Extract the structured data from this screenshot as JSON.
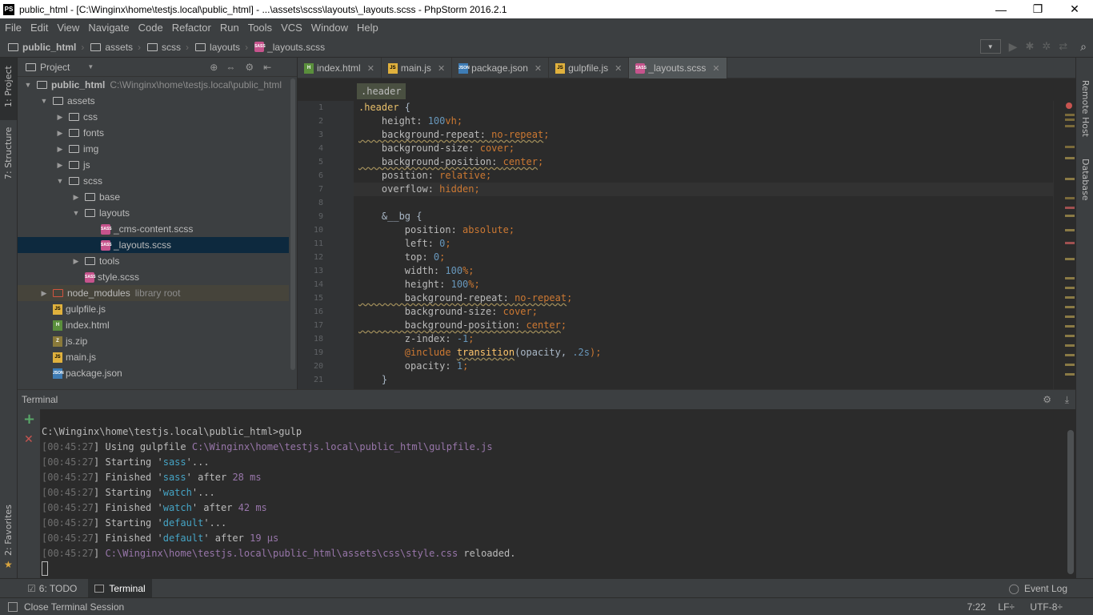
{
  "window": {
    "title": "public_html - [C:\\Winginx\\home\\testjs.local\\public_html] - ...\\assets\\scss\\layouts\\_layouts.scss - PhpStorm 2016.2.1",
    "logo": "PS",
    "minimize": "—",
    "maximize": "❐",
    "close": "✕"
  },
  "menu": [
    "File",
    "Edit",
    "View",
    "Navigate",
    "Code",
    "Refactor",
    "Run",
    "Tools",
    "VCS",
    "Window",
    "Help"
  ],
  "breadcrumbs": [
    "public_html",
    "assets",
    "scss",
    "layouts",
    "_layouts.scss"
  ],
  "left_strip": {
    "project": "1: Project",
    "structure": "7: Structure",
    "favorites": "2: Favorites"
  },
  "right_strip": {
    "remote_host": "Remote Host",
    "database": "Database"
  },
  "project_panel": {
    "title": "Project",
    "tree": [
      {
        "label": "public_html",
        "hint": "C:\\Winginx\\home\\testjs.local\\public_html",
        "type": "folder",
        "depth": 0,
        "expanded": true,
        "bold": true
      },
      {
        "label": "assets",
        "type": "folder",
        "depth": 1,
        "expanded": true
      },
      {
        "label": "css",
        "type": "folder",
        "depth": 2,
        "expanded": false
      },
      {
        "label": "fonts",
        "type": "folder",
        "depth": 2,
        "expanded": false
      },
      {
        "label": "img",
        "type": "folder",
        "depth": 2,
        "expanded": false
      },
      {
        "label": "js",
        "type": "folder",
        "depth": 2,
        "expanded": false
      },
      {
        "label": "scss",
        "type": "folder",
        "depth": 2,
        "expanded": true
      },
      {
        "label": "base",
        "type": "folder",
        "depth": 3,
        "expanded": false
      },
      {
        "label": "layouts",
        "type": "folder",
        "depth": 3,
        "expanded": true
      },
      {
        "label": "_cms-content.scss",
        "type": "sass",
        "depth": 4
      },
      {
        "label": "_layouts.scss",
        "type": "sass",
        "depth": 4,
        "selected": true
      },
      {
        "label": "tools",
        "type": "folder",
        "depth": 3,
        "expanded": false
      },
      {
        "label": "style.scss",
        "type": "sass",
        "depth": 3
      },
      {
        "label": "node_modules",
        "hint": "library root",
        "type": "folder-lib",
        "depth": 1,
        "expanded": false
      },
      {
        "label": "gulpfile.js",
        "type": "js",
        "depth": 1
      },
      {
        "label": "index.html",
        "type": "html",
        "depth": 1
      },
      {
        "label": "js.zip",
        "type": "zip",
        "depth": 1
      },
      {
        "label": "main.js",
        "type": "js",
        "depth": 1
      },
      {
        "label": "package.json",
        "type": "json",
        "depth": 1
      }
    ]
  },
  "editor_tabs": [
    {
      "label": "index.html",
      "type": "html"
    },
    {
      "label": "main.js",
      "type": "js"
    },
    {
      "label": "package.json",
      "type": "json"
    },
    {
      "label": "gulpfile.js",
      "type": "js"
    },
    {
      "label": "_layouts.scss",
      "type": "sass",
      "active": true
    }
  ],
  "editor": {
    "breadcrumb": ".header",
    "line_numbers": [
      "1",
      "2",
      "3",
      "4",
      "5",
      "6",
      "7",
      "8",
      "9",
      "10",
      "11",
      "12",
      "13",
      "14",
      "15",
      "16",
      "17",
      "18",
      "19",
      "20",
      "21"
    ],
    "lines": [
      [
        {
          "t": ".header",
          "c": "sel-c"
        },
        {
          "t": " {",
          "c": "tx"
        }
      ],
      [
        {
          "t": "    height: ",
          "c": "prop"
        },
        {
          "t": "100",
          "c": "num"
        },
        {
          "t": "vh",
          "c": "kw"
        },
        {
          "t": ";",
          "c": "kw"
        }
      ],
      [
        {
          "t": "    background-repeat: ",
          "c": "prop wavy"
        },
        {
          "t": "no-repeat",
          "c": "kw wavy"
        },
        {
          "t": ";",
          "c": "kw"
        }
      ],
      [
        {
          "t": "    background-size: ",
          "c": "prop"
        },
        {
          "t": "cover",
          "c": "kw"
        },
        {
          "t": ";",
          "c": "kw"
        }
      ],
      [
        {
          "t": "    background-position: ",
          "c": "prop wavy"
        },
        {
          "t": "center",
          "c": "kw wavy"
        },
        {
          "t": ";",
          "c": "kw"
        }
      ],
      [
        {
          "t": "    position: ",
          "c": "prop"
        },
        {
          "t": "relative",
          "c": "kw"
        },
        {
          "t": ";",
          "c": "kw"
        }
      ],
      [
        {
          "t": "    overflow: ",
          "c": "prop"
        },
        {
          "t": "hidden",
          "c": "kw"
        },
        {
          "t": ";",
          "c": "kw"
        }
      ],
      [],
      [
        {
          "t": "    &__bg {",
          "c": "tx"
        }
      ],
      [
        {
          "t": "        position: ",
          "c": "prop"
        },
        {
          "t": "absolute",
          "c": "kw"
        },
        {
          "t": ";",
          "c": "kw"
        }
      ],
      [
        {
          "t": "        left: ",
          "c": "prop"
        },
        {
          "t": "0",
          "c": "num"
        },
        {
          "t": ";",
          "c": "kw"
        }
      ],
      [
        {
          "t": "        top: ",
          "c": "prop"
        },
        {
          "t": "0",
          "c": "num"
        },
        {
          "t": ";",
          "c": "kw"
        }
      ],
      [
        {
          "t": "        width: ",
          "c": "prop"
        },
        {
          "t": "100",
          "c": "num"
        },
        {
          "t": "%",
          "c": "kw"
        },
        {
          "t": ";",
          "c": "kw"
        }
      ],
      [
        {
          "t": "        height: ",
          "c": "prop"
        },
        {
          "t": "100",
          "c": "num"
        },
        {
          "t": "%",
          "c": "kw"
        },
        {
          "t": ";",
          "c": "kw"
        }
      ],
      [
        {
          "t": "        background-repeat: ",
          "c": "prop wavy"
        },
        {
          "t": "no-repeat",
          "c": "kw wavy"
        },
        {
          "t": ";",
          "c": "kw"
        }
      ],
      [
        {
          "t": "        background-size: ",
          "c": "prop"
        },
        {
          "t": "cover",
          "c": "kw"
        },
        {
          "t": ";",
          "c": "kw"
        }
      ],
      [
        {
          "t": "        background-position: ",
          "c": "prop wavy"
        },
        {
          "t": "center",
          "c": "kw wavy"
        },
        {
          "t": ";",
          "c": "kw"
        }
      ],
      [
        {
          "t": "        z-index: ",
          "c": "prop"
        },
        {
          "t": "-1",
          "c": "num"
        },
        {
          "t": ";",
          "c": "kw"
        }
      ],
      [
        {
          "t": "        @include ",
          "c": "inc"
        },
        {
          "t": "transition",
          "c": "fn wavy"
        },
        {
          "t": "(opacity, ",
          "c": "tx"
        },
        {
          "t": ".2s",
          "c": "num"
        },
        {
          "t": ");",
          "c": "kw"
        }
      ],
      [
        {
          "t": "        opacity: ",
          "c": "prop"
        },
        {
          "t": "1",
          "c": "num"
        },
        {
          "t": ";",
          "c": "kw"
        }
      ],
      [
        {
          "t": "    }",
          "c": "tx"
        }
      ]
    ]
  },
  "terminal": {
    "title": "Terminal",
    "add": "+",
    "close": "✕",
    "prompt": "C:\\Winginx\\home\\testjs.local\\public_html>gulp",
    "lines": [
      [
        {
          "t": "[",
          "c": "ts"
        },
        {
          "t": "00:45:27",
          "c": "ts"
        },
        {
          "t": "] Using gulpfile ",
          "c": ""
        },
        {
          "t": "C:\\Winginx\\home\\testjs.local\\public_html\\gulpfile.js",
          "c": "tp"
        }
      ],
      [
        {
          "t": "[",
          "c": "ts"
        },
        {
          "t": "00:45:27",
          "c": "ts"
        },
        {
          "t": "] Starting '",
          "c": ""
        },
        {
          "t": "sass",
          "c": "tc"
        },
        {
          "t": "'...",
          "c": ""
        }
      ],
      [
        {
          "t": "[",
          "c": "ts"
        },
        {
          "t": "00:45:27",
          "c": "ts"
        },
        {
          "t": "] Finished '",
          "c": ""
        },
        {
          "t": "sass",
          "c": "tc"
        },
        {
          "t": "' after ",
          "c": ""
        },
        {
          "t": "28 ms",
          "c": "tn"
        }
      ],
      [
        {
          "t": "[",
          "c": "ts"
        },
        {
          "t": "00:45:27",
          "c": "ts"
        },
        {
          "t": "] Starting '",
          "c": ""
        },
        {
          "t": "watch",
          "c": "tc"
        },
        {
          "t": "'...",
          "c": ""
        }
      ],
      [
        {
          "t": "[",
          "c": "ts"
        },
        {
          "t": "00:45:27",
          "c": "ts"
        },
        {
          "t": "] Finished '",
          "c": ""
        },
        {
          "t": "watch",
          "c": "tc"
        },
        {
          "t": "' after ",
          "c": ""
        },
        {
          "t": "42 ms",
          "c": "tn"
        }
      ],
      [
        {
          "t": "[",
          "c": "ts"
        },
        {
          "t": "00:45:27",
          "c": "ts"
        },
        {
          "t": "] Starting '",
          "c": ""
        },
        {
          "t": "default",
          "c": "tc"
        },
        {
          "t": "'...",
          "c": ""
        }
      ],
      [
        {
          "t": "[",
          "c": "ts"
        },
        {
          "t": "00:45:27",
          "c": "ts"
        },
        {
          "t": "] Finished '",
          "c": ""
        },
        {
          "t": "default",
          "c": "tc"
        },
        {
          "t": "' after ",
          "c": ""
        },
        {
          "t": "19 μs",
          "c": "tn"
        }
      ],
      [
        {
          "t": "[",
          "c": "ts"
        },
        {
          "t": "00:45:27",
          "c": "ts"
        },
        {
          "t": "] ",
          "c": ""
        },
        {
          "t": "C:\\Winginx\\home\\testjs.local\\public_html\\assets\\css\\style.css",
          "c": "tp"
        },
        {
          "t": " reloaded.",
          "c": ""
        }
      ]
    ]
  },
  "bottom_tabs": {
    "todo": "6: TODO",
    "terminal": "Terminal",
    "event_log": "Event Log"
  },
  "status": {
    "message": "Close Terminal Session",
    "position": "7:22",
    "line_sep": "LF÷",
    "encoding": "UTF-8÷"
  },
  "colors": {
    "accent": "#0d293e",
    "bg": "#3c3f41",
    "editor_bg": "#2b2b2b"
  }
}
